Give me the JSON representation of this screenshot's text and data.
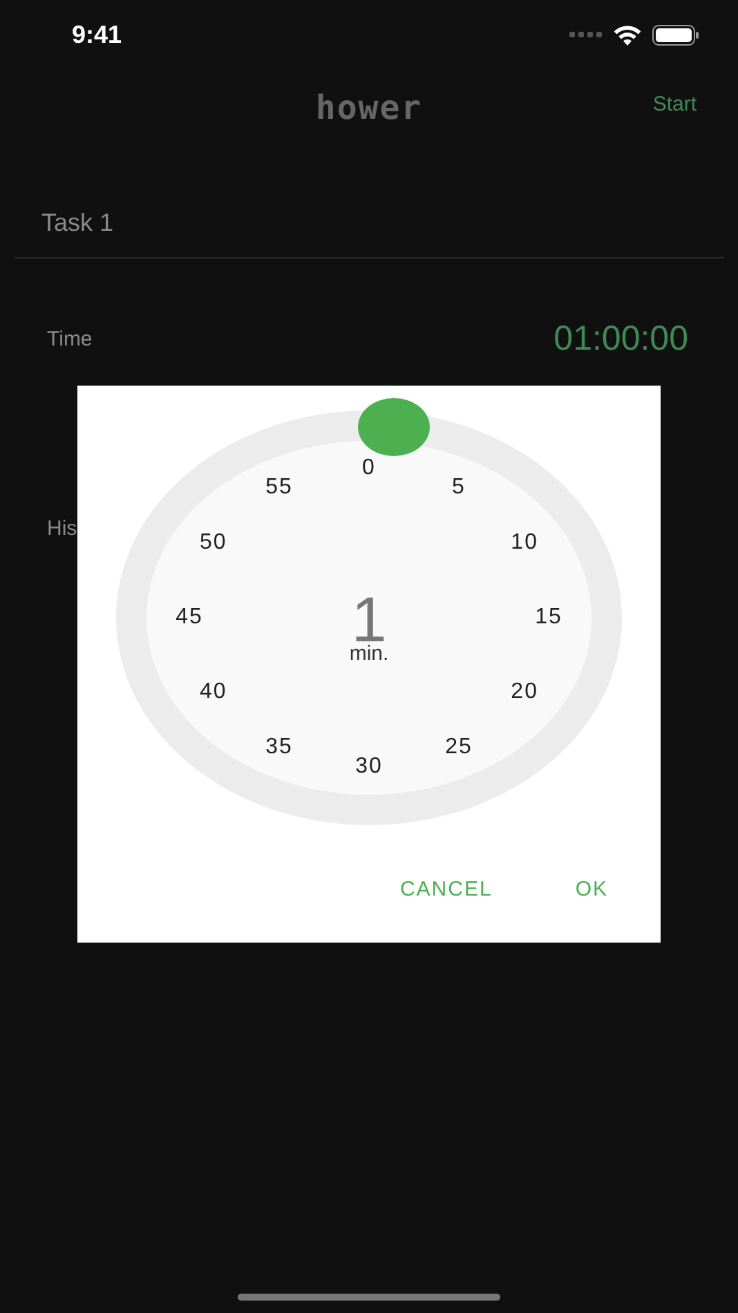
{
  "status_bar": {
    "time": "9:41"
  },
  "nav": {
    "logo": "hower",
    "action": "Start"
  },
  "task": {
    "name": "Task 1"
  },
  "time_row": {
    "label": "Time",
    "value": "01:00:00"
  },
  "history": {
    "label": "His"
  },
  "dialog": {
    "dial_labels": [
      "0",
      "5",
      "10",
      "15",
      "20",
      "25",
      "30",
      "35",
      "40",
      "45",
      "50",
      "55"
    ],
    "value": "1",
    "unit": "min.",
    "buttons": [
      {
        "label": "CANCEL"
      },
      {
        "label": "OK"
      }
    ]
  }
}
